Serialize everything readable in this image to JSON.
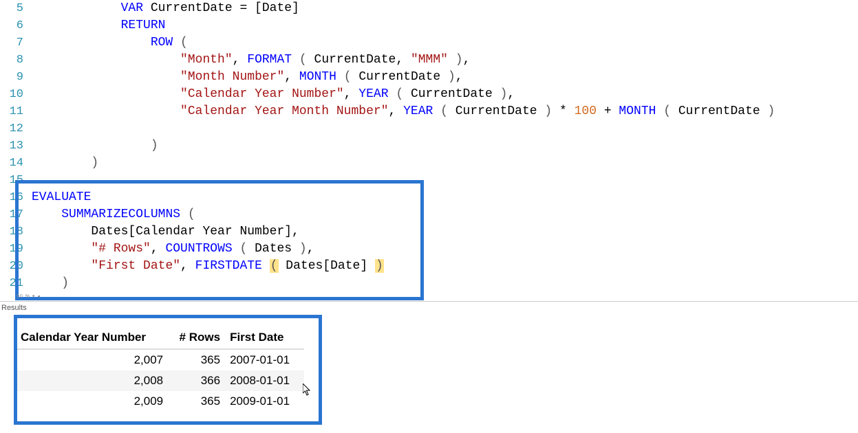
{
  "code": {
    "lines": [
      {
        "n": 5,
        "html": "            <span class='kw'>VAR</span> CurrentDate = [Date]"
      },
      {
        "n": 6,
        "html": "            <span class='kw'>RETURN</span>"
      },
      {
        "n": 7,
        "html": "                <span class='fn'>ROW</span> <span class='punct'>(</span>"
      },
      {
        "n": 8,
        "html": "                    <span class='str'>\"Month\"</span>, <span class='fn'>FORMAT</span> <span class='punct'>(</span> CurrentDate, <span class='str'>\"MMM\"</span> <span class='punct'>)</span>,"
      },
      {
        "n": 9,
        "html": "                    <span class='str'>\"Month Number\"</span>, <span class='fn'>MONTH</span> <span class='punct'>(</span> CurrentDate <span class='punct'>)</span>,"
      },
      {
        "n": 10,
        "html": "                    <span class='str'>\"Calendar Year Number\"</span>, <span class='fn'>YEAR</span> <span class='punct'>(</span> CurrentDate <span class='punct'>)</span>,"
      },
      {
        "n": 11,
        "html": "                    <span class='str'>\"Calendar Year Month Number\"</span>, <span class='fn'>YEAR</span> <span class='punct'>(</span> CurrentDate <span class='punct'>)</span> * <span class='num'>100</span> + <span class='fn'>MONTH</span> <span class='punct'>(</span> CurrentDate <span class='punct'>)</span>"
      },
      {
        "n": 12,
        "html": ""
      },
      {
        "n": 13,
        "html": "                <span class='punct'>)</span>"
      },
      {
        "n": 14,
        "html": "        <span class='punct'>)</span>"
      },
      {
        "n": 15,
        "html": ""
      },
      {
        "n": 16,
        "html": "<span class='kw'>EVALUATE</span>"
      },
      {
        "n": 17,
        "html": "    <span class='fn'>SUMMARIZECOLUMNS</span> <span class='punct'>(</span>"
      },
      {
        "n": 18,
        "html": "        Dates[Calendar Year Number],"
      },
      {
        "n": 19,
        "html": "        <span class='str'>\"# Rows\"</span>, <span class='fn'>COUNTROWS</span> <span class='punct'>(</span> Dates <span class='punct'>)</span>,"
      },
      {
        "n": 20,
        "html": "        <span class='str'>\"First Date\"</span>, <span class='fn'>FIRSTDATE</span> <span class='hlp'>(</span> Dates[Date] <span class='hlp'>)</span>"
      },
      {
        "n": 21,
        "html": "    <span class='punct'>)</span>"
      }
    ]
  },
  "zoom": "90 % ▾  ◂",
  "resultsLabel": "Results",
  "results": {
    "headers": [
      "Calendar Year Number",
      "# Rows",
      "First Date"
    ],
    "rows": [
      {
        "year": "2,007",
        "rows": "365",
        "date": "2007-01-01"
      },
      {
        "year": "2,008",
        "rows": "366",
        "date": "2008-01-01"
      },
      {
        "year": "2,009",
        "rows": "365",
        "date": "2009-01-01"
      }
    ]
  }
}
